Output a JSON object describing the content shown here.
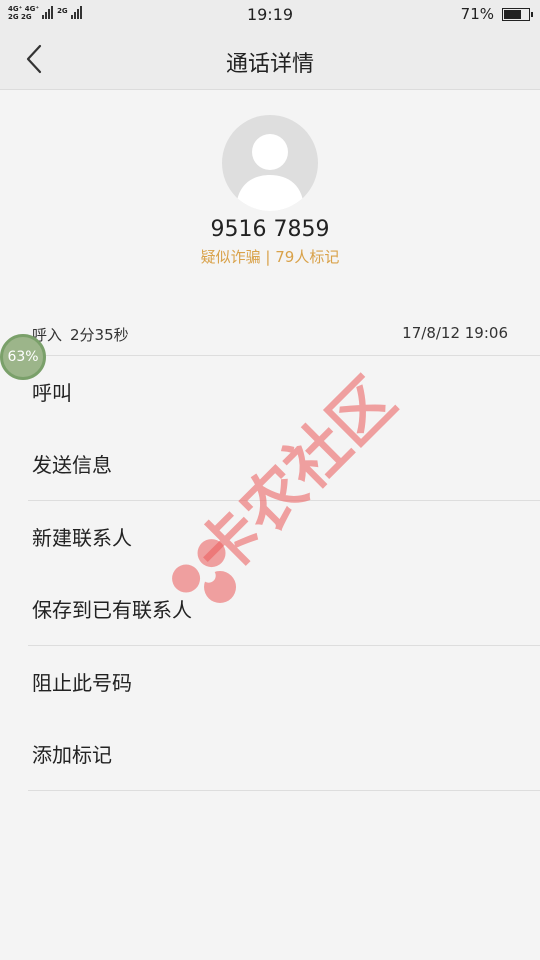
{
  "status_bar": {
    "net_top": "4G⁺ 4G⁺",
    "net_bottom": "2G 2G",
    "net_extra": "2G",
    "time": "19:19",
    "battery_text": "71%",
    "battery_level": 0.71
  },
  "header": {
    "title": "通话详情"
  },
  "contact": {
    "number": "9516 7859",
    "tag": "疑似诈骗 | 79人标记"
  },
  "call_log": {
    "direction": "呼入",
    "duration": "2分35秒",
    "timestamp": "17/8/12 19:06"
  },
  "actions": [
    "呼叫",
    "发送信息",
    "新建联系人",
    "保存到已有联系人",
    "阻止此号码",
    "添加标记"
  ],
  "float_badge": "63%",
  "watermark": "卡农社区",
  "colors": {
    "tag": "#d9a24a",
    "background": "#f4f4f4",
    "watermark": "#eb5a5a"
  }
}
